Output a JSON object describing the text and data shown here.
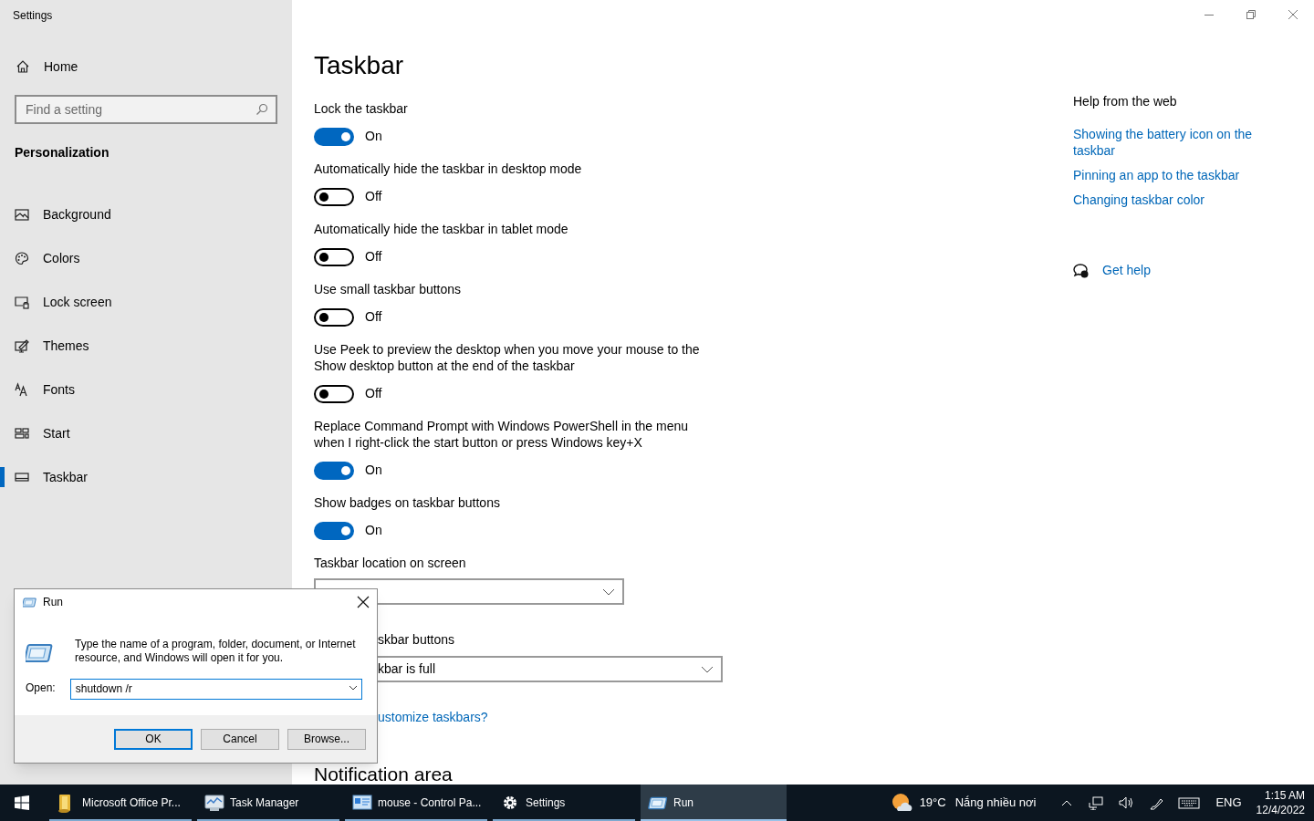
{
  "window": {
    "title": "Settings"
  },
  "sidebar": {
    "home": "Home",
    "search": {
      "placeholder": "Find a setting"
    },
    "section": "Personalization",
    "items": [
      {
        "label": "Background",
        "selected": false
      },
      {
        "label": "Colors",
        "selected": false
      },
      {
        "label": "Lock screen",
        "selected": false
      },
      {
        "label": "Themes",
        "selected": false
      },
      {
        "label": "Fonts",
        "selected": false
      },
      {
        "label": "Start",
        "selected": false
      },
      {
        "label": "Taskbar",
        "selected": true
      }
    ]
  },
  "page": {
    "title": "Taskbar",
    "settings": [
      {
        "kind": "toggle",
        "label": "Lock the taskbar",
        "on": true,
        "state_text": "On"
      },
      {
        "kind": "toggle",
        "label": "Automatically hide the taskbar in desktop mode",
        "on": false,
        "state_text": "Off"
      },
      {
        "kind": "toggle",
        "label": "Automatically hide the taskbar in tablet mode",
        "on": false,
        "state_text": "Off"
      },
      {
        "kind": "toggle",
        "label": "Use small taskbar buttons",
        "on": false,
        "state_text": "Off"
      },
      {
        "kind": "toggle",
        "label": "Use Peek to preview the desktop when you move your mouse to the Show desktop button at the end of the taskbar",
        "on": false,
        "state_text": "Off"
      },
      {
        "kind": "toggle",
        "label": "Replace Command Prompt with Windows PowerShell in the menu when I right-click the start button or press Windows key+X",
        "on": true,
        "state_text": "On"
      },
      {
        "kind": "toggle",
        "label": "Show badges on taskbar buttons",
        "on": true,
        "state_text": "On"
      },
      {
        "kind": "dropdown",
        "label": "Taskbar location on screen"
      },
      {
        "kind": "covered_dropdown",
        "label": "skbar buttons",
        "value": "kbar is full"
      },
      {
        "kind": "covered_link",
        "label": "ustomize taskbars?"
      },
      {
        "kind": "heading",
        "label": "Notification area"
      }
    ]
  },
  "help": {
    "title": "Help from the web",
    "links": [
      "Showing the battery icon on the taskbar",
      "Pinning an app to the taskbar",
      "Changing taskbar color"
    ],
    "get_help": "Get help"
  },
  "run_dialog": {
    "title": "Run",
    "description": "Type the name of a program, folder, document, or Internet resource, and Windows will open it for you.",
    "open_label": "Open:",
    "value": "shutdown /r",
    "buttons": [
      "OK",
      "Cancel",
      "Browse..."
    ]
  },
  "taskbar": {
    "apps": [
      {
        "label": "Microsoft Office Pr...",
        "selected": false
      },
      {
        "label": "Task Manager",
        "selected": false
      },
      {
        "label": "mouse - Control Pa...",
        "selected": false
      },
      {
        "label": "Settings",
        "selected": false
      },
      {
        "label": "Run",
        "selected": true
      }
    ],
    "weather": {
      "temperature": "19°C",
      "condition": "Nắng nhiều nơi"
    },
    "language": "ENG",
    "time": "1:15 AM",
    "date": "12/4/2022"
  }
}
